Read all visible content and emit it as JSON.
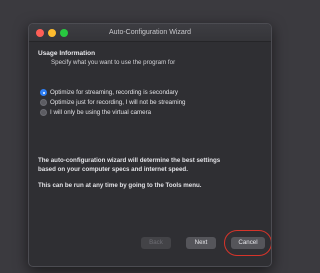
{
  "window": {
    "title": "Auto-Configuration Wizard"
  },
  "usage": {
    "heading": "Usage Information",
    "subtitle": "Specify what you want to use the program for"
  },
  "options": [
    {
      "label": "Optimize for streaming, recording is secondary",
      "selected": true
    },
    {
      "label": "Optimize just for recording, I will not be streaming",
      "selected": false
    },
    {
      "label": "I will only be using the virtual camera",
      "selected": false
    }
  ],
  "info": {
    "line1": "The auto-configuration wizard will determine the best settings",
    "line2": "based on your computer specs and internet speed.",
    "line3": "This can be run at any time by going to the Tools menu."
  },
  "buttons": {
    "back": "Back",
    "next": "Next",
    "cancel": "Cancel"
  },
  "colors": {
    "accent": "#2f7ff5",
    "highlight": "#d6342a"
  }
}
